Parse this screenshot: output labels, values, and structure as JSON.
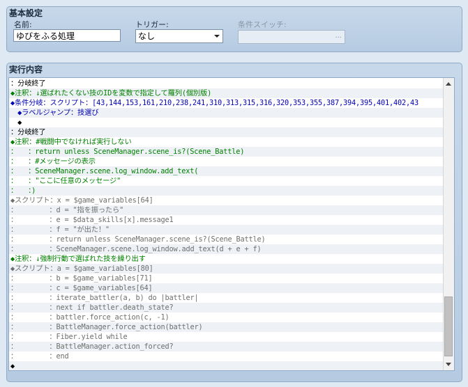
{
  "basic_settings": {
    "title": "基本設定",
    "name_label": "名前:",
    "name_value": "ゆびをふる処理",
    "trigger_label": "トリガー:",
    "trigger_value": "なし",
    "switch_label": "条件スイッチ:",
    "switch_button": "..."
  },
  "execution": {
    "title": "実行内容",
    "rows": [
      {
        "text": "：分岐終了",
        "color": "black"
      },
      {
        "text": "◆注釈：↓選ばれたくない技のIDを変数で指定して羅列(個別版)",
        "color": "green"
      },
      {
        "text": "◆条件分岐：スクリプト：[43,144,153,161,210,238,241,310,313,315,316,320,353,355,387,394,395,401,402,43",
        "color": "blue"
      },
      {
        "text": "　◆ラベルジャンプ：技選び",
        "color": "blue"
      },
      {
        "text": "　◆",
        "color": "black"
      },
      {
        "text": "：分岐終了",
        "color": "black"
      },
      {
        "text": "◆注釈：#戦闘中でなければ実行しない",
        "color": "green"
      },
      {
        "text": "：　　：return unless SceneManager.scene_is?(Scene_Battle)",
        "color": "green"
      },
      {
        "text": "：　　：#メッセージの表示",
        "color": "green"
      },
      {
        "text": "：　　：SceneManager.scene.log_window.add_text(",
        "color": "green"
      },
      {
        "text": "：　　：\"ここに任意のメッセージ\"",
        "color": "green"
      },
      {
        "text": "：　　：)",
        "color": "green"
      },
      {
        "text": "◆スクリプト：x = $game_variables[64]",
        "color": "gray"
      },
      {
        "text": "：　　　　　：d = \"指を振ったら\"",
        "color": "gray"
      },
      {
        "text": "：　　　　　：e = $data_skills[x].message1",
        "color": "gray"
      },
      {
        "text": "：　　　　　：f = \"が出た！\"",
        "color": "gray"
      },
      {
        "text": "：　　　　　：return unless SceneManager.scene_is?(Scene_Battle)",
        "color": "gray"
      },
      {
        "text": "：　　　　　：SceneManager.scene.log_window.add_text(d + e + f)",
        "color": "gray"
      },
      {
        "text": "◆注釈：↓強制行動で選ばれた技を繰り出す",
        "color": "green"
      },
      {
        "text": "◆スクリプト：a = $game_variables[80]",
        "color": "gray"
      },
      {
        "text": "：　　　　　：b = $game_variables[71]",
        "color": "gray"
      },
      {
        "text": "：　　　　　：c = $game_variables[64]",
        "color": "gray"
      },
      {
        "text": "：　　　　　：iterate_battler(a, b) do |battler|",
        "color": "gray"
      },
      {
        "text": "：　　　　　：next if battler.death_state?",
        "color": "gray"
      },
      {
        "text": "：　　　　　：battler.force_action(c, -1)",
        "color": "gray"
      },
      {
        "text": "：　　　　　：BattleManager.force_action(battler)",
        "color": "gray"
      },
      {
        "text": "：　　　　　：Fiber.yield while",
        "color": "gray"
      },
      {
        "text": "：　　　　　：BattleManager.action_forced?",
        "color": "gray"
      },
      {
        "text": "：　　　　　：end",
        "color": "gray"
      },
      {
        "text": "◆",
        "color": "black"
      }
    ]
  },
  "icons": {
    "dropdown": "chevron-down-icon",
    "scroll_up": "arrow-up-icon",
    "scroll_down": "arrow-down-icon"
  }
}
